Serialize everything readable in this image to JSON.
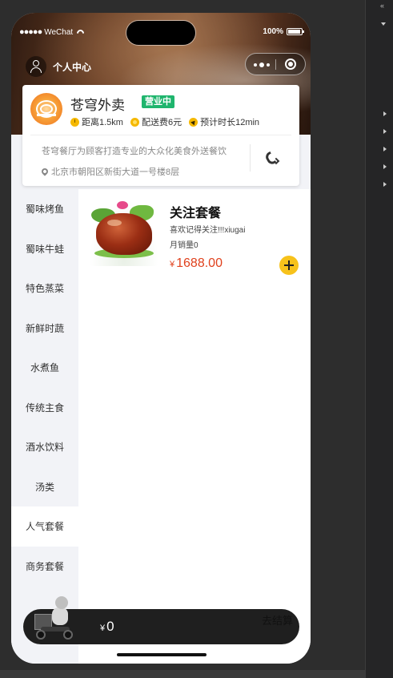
{
  "status_bar": {
    "carrier": "WeChat",
    "battery": "100%"
  },
  "header": {
    "user_center_label": "个人中心"
  },
  "store": {
    "name": "苍穹外卖",
    "status_badge": "营业中",
    "distance": "距离1.5km",
    "delivery_fee": "配送费6元",
    "eta": "预计时长12min",
    "description": "苍穹餐厅为顾客打造专业的大众化美食外送餐饮",
    "address": "北京市朝阳区新街大道一号楼8层"
  },
  "sidebar": {
    "items": [
      {
        "label": "蜀味烤鱼"
      },
      {
        "label": "蜀味牛蛙"
      },
      {
        "label": "特色蒸菜"
      },
      {
        "label": "新鲜时蔬"
      },
      {
        "label": "水煮鱼"
      },
      {
        "label": "传统主食"
      },
      {
        "label": "酒水饮料"
      },
      {
        "label": "汤类"
      },
      {
        "label": "人气套餐",
        "active": true
      },
      {
        "label": "商务套餐"
      }
    ]
  },
  "dishes": [
    {
      "name": "关注套餐",
      "description": "喜欢记得关注!!!xiugai",
      "sales": "月销量0",
      "currency": "¥",
      "price": "1688.00"
    }
  ],
  "cart": {
    "currency": "¥",
    "total": "0",
    "checkout_label": "去结算"
  },
  "colors": {
    "accent": "#f7c21b",
    "price": "#e0411d",
    "open_badge": "#1fb56d",
    "cart_bar": "#1f1f1f"
  }
}
